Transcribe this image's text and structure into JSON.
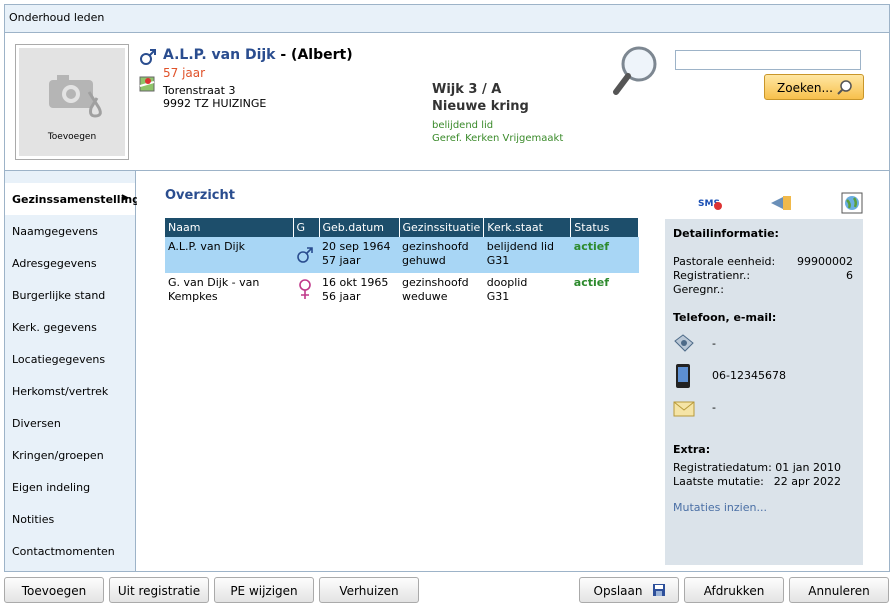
{
  "window": {
    "title": "Onderhoud leden"
  },
  "member": {
    "photo_label": "Toevoegen",
    "name": "A.L.P. van Dijk",
    "nickname": "- (Albert)",
    "age": "57 jaar",
    "street": "Torenstraat 3",
    "city": "9992 TZ HUIZINGE",
    "wijk": "Wijk 3 / A",
    "kring": "Nieuwe kring",
    "status": "belijdend lid",
    "church": "Geref. Kerken Vrijgemaakt"
  },
  "search": {
    "value": "",
    "button": "Zoeken..."
  },
  "nav": [
    {
      "label": "Gezinssamenstelling"
    },
    {
      "label": "Naamgegevens"
    },
    {
      "label": "Adresgegevens"
    },
    {
      "label": "Burgerlijke stand"
    },
    {
      "label": "Kerk. gegevens"
    },
    {
      "label": "Locatiegegevens"
    },
    {
      "label": "Herkomst/vertrek"
    },
    {
      "label": "Diversen"
    },
    {
      "label": "Kringen/groepen"
    },
    {
      "label": "Eigen indeling"
    },
    {
      "label": "Notities"
    },
    {
      "label": "Contactmomenten"
    }
  ],
  "overview": {
    "title": "Overzicht",
    "columns": [
      "Naam",
      "G",
      "Geb.datum",
      "Gezinssituatie",
      "Kerk.staat",
      "Status"
    ],
    "rows": [
      {
        "name": "A.L.P. van Dijk",
        "gender": "male",
        "birth": "20 sep 1964",
        "age": "57 jaar",
        "situatie1": "gezinshoofd",
        "situatie2": "gehuwd",
        "kerk1": "belijdend lid",
        "kerk2": "G31",
        "status": "actief"
      },
      {
        "name": "G. van Dijk - van Kempkes",
        "gender": "female",
        "birth": "16 okt 1965",
        "age": "56 jaar",
        "situatie1": "gezinshoofd",
        "situatie2": "weduwe",
        "kerk1": "dooplid",
        "kerk2": "G31",
        "status": "actief"
      }
    ]
  },
  "detail": {
    "title": "Detailinformatie:",
    "pe_label": "Pastorale eenheid:",
    "pe_value": "99900002",
    "reg_label": "Registratienr.:",
    "reg_value": "6",
    "gereg_label": "Geregnr.:",
    "contact_title": "Telefoon, e-mail:",
    "phone": "-",
    "mobile": "06-12345678",
    "email": "-",
    "extra_title": "Extra:",
    "regdate_label": "Registratiedatum:",
    "regdate_value": "01 jan 2010",
    "mut_label": "Laatste mutatie:",
    "mut_value": "22 apr 2022",
    "mut_link": "Mutaties inzien..."
  },
  "buttons": {
    "add": "Toevoegen",
    "unreg": "Uit registratie",
    "pe": "PE wijzigen",
    "move": "Verhuizen",
    "save": "Opslaan",
    "print": "Afdrukken",
    "cancel": "Annuleren"
  },
  "colors": {
    "accent": "#1d4e6b",
    "selected_row": "#a8d6f5",
    "status_green": "#2d8a2d",
    "age": "#e0522a"
  }
}
